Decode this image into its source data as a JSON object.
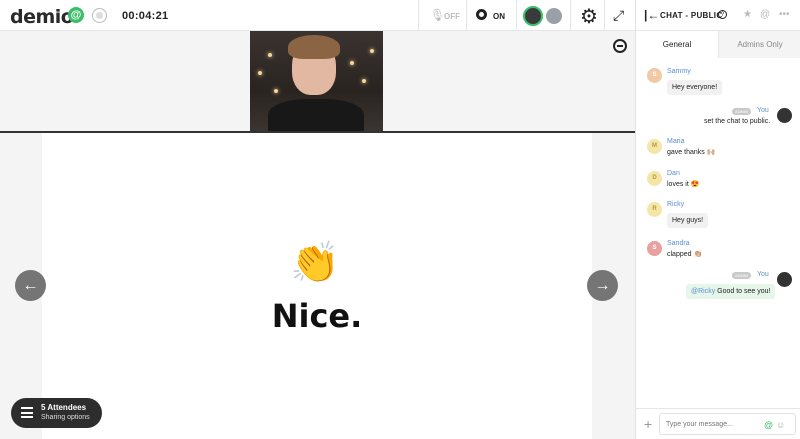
{
  "app": {
    "logo": "demio",
    "logo_badge": "@",
    "timer": "00:04:21"
  },
  "toolbar": {
    "mic_label": "OFF",
    "cam_label": "ON"
  },
  "slide": {
    "emoji": "👏",
    "text": "Nice."
  },
  "attendees": {
    "count_label": "5 Attendees",
    "sub_label": "Sharing options"
  },
  "chat": {
    "title": "CHAT - PUBLIC",
    "tabs": [
      {
        "label": "General"
      },
      {
        "label": "Admins Only"
      }
    ],
    "messages": [
      {
        "initial": "S",
        "name": "Sammy",
        "text": "Hey everyone!",
        "color": "#f2c9a6"
      },
      {
        "badge": "ADMIN",
        "name": "You",
        "text": "set the chat to public."
      },
      {
        "initial": "M",
        "name": "Maria",
        "text": "gave thanks 🙌🏼",
        "color": "#f5e6a8"
      },
      {
        "initial": "D",
        "name": "Dan",
        "text": "loves it 😍",
        "color": "#f5e6a8"
      },
      {
        "initial": "R",
        "name": "Ricky",
        "text": "Hey guys!",
        "color": "#f5e6a8"
      },
      {
        "initial": "S",
        "name": "Sandra",
        "text": "clapped 👏🏼",
        "color": "#e8a0a0"
      },
      {
        "badge": "ADMIN",
        "name": "You",
        "mention": "@Ricky",
        "text": " Good to see you!"
      }
    ],
    "input_placeholder": "Type your message..."
  },
  "colors": {
    "brand_green": "#3cbf6a",
    "link_blue": "#5a8fd6"
  }
}
